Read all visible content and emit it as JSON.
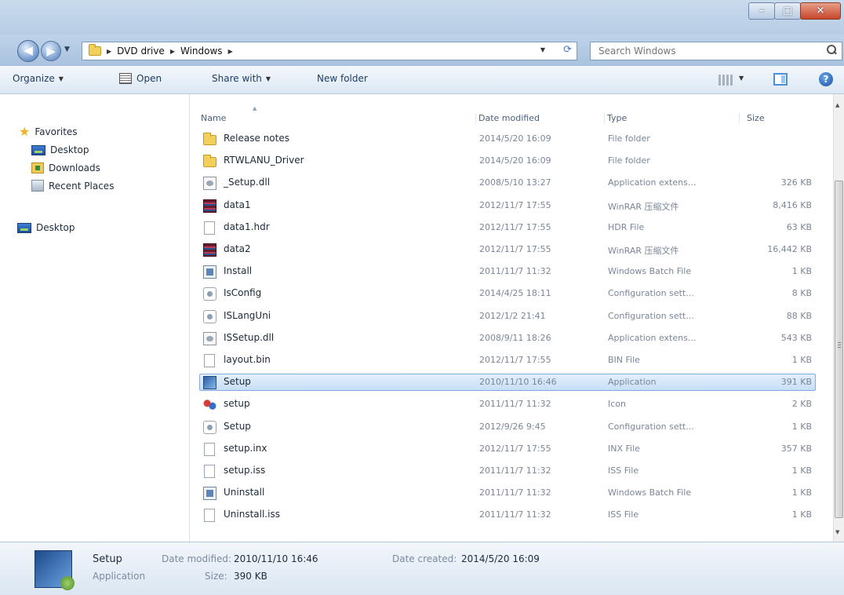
{
  "window": {
    "minimize": "–",
    "maximize": "□",
    "close": "✕"
  },
  "nav": {
    "breadcrumb": [
      "DVD drive",
      "Windows"
    ],
    "search_placeholder": "Search Windows"
  },
  "toolbar": {
    "organize": "Organize",
    "open": "Open",
    "share_with": "Share with",
    "new_folder": "New folder",
    "help": "?"
  },
  "navpane": {
    "favorites": "Favorites",
    "items": [
      "Desktop",
      "Downloads",
      "Recent Places"
    ],
    "desktop_root": "Desktop"
  },
  "columns": {
    "name": "Name",
    "date": "Date modified",
    "type": "Type",
    "size": "Size"
  },
  "files": [
    {
      "name": "Release notes",
      "date": "2014/5/20 16:09",
      "type": "File folder",
      "size": "",
      "icon": "folder-icon"
    },
    {
      "name": "RTWLANU_Driver",
      "date": "2014/5/20 16:09",
      "type": "File folder",
      "size": "",
      "icon": "folder-icon"
    },
    {
      "name": "_Setup.dll",
      "date": "2008/5/10 13:27",
      "type": "Application extens...",
      "size": "326 KB",
      "icon": "dll-icon"
    },
    {
      "name": "data1",
      "date": "2012/11/7 17:55",
      "type": "WinRAR 压缩文件",
      "size": "8,416 KB",
      "icon": "rar-icon"
    },
    {
      "name": "data1.hdr",
      "date": "2012/11/7 17:55",
      "type": "HDR File",
      "size": "63 KB",
      "icon": "file-icon"
    },
    {
      "name": "data2",
      "date": "2012/11/7 17:55",
      "type": "WinRAR 压缩文件",
      "size": "16,442 KB",
      "icon": "rar-icon"
    },
    {
      "name": "Install",
      "date": "2011/11/7 11:32",
      "type": "Windows Batch File",
      "size": "1 KB",
      "icon": "batch-icon"
    },
    {
      "name": "IsConfig",
      "date": "2014/4/25 18:11",
      "type": "Configuration sett...",
      "size": "8 KB",
      "icon": "config-icon"
    },
    {
      "name": "ISLangUni",
      "date": "2012/1/2 21:41",
      "type": "Configuration sett...",
      "size": "88 KB",
      "icon": "config-icon"
    },
    {
      "name": "ISSetup.dll",
      "date": "2008/9/11 18:26",
      "type": "Application extens...",
      "size": "543 KB",
      "icon": "dll-icon"
    },
    {
      "name": "layout.bin",
      "date": "2012/11/7 17:55",
      "type": "BIN File",
      "size": "1 KB",
      "icon": "file-icon"
    },
    {
      "name": "Setup",
      "date": "2010/11/10 16:46",
      "type": "Application",
      "size": "391 KB",
      "icon": "app-icon",
      "selected": true
    },
    {
      "name": "setup",
      "date": "2011/11/7 11:32",
      "type": "Icon",
      "size": "2 KB",
      "icon": "ico-icon"
    },
    {
      "name": "Setup",
      "date": "2012/9/26 9:45",
      "type": "Configuration sett...",
      "size": "1 KB",
      "icon": "config-icon"
    },
    {
      "name": "setup.inx",
      "date": "2012/11/7 17:55",
      "type": "INX File",
      "size": "357 KB",
      "icon": "file-icon"
    },
    {
      "name": "setup.iss",
      "date": "2011/11/7 11:32",
      "type": "ISS File",
      "size": "1 KB",
      "icon": "file-icon"
    },
    {
      "name": "Uninstall",
      "date": "2011/11/7 11:32",
      "type": "Windows Batch File",
      "size": "1 KB",
      "icon": "batch-icon"
    },
    {
      "name": "Uninstall.iss",
      "date": "2011/11/7 11:32",
      "type": "ISS File",
      "size": "1 KB",
      "icon": "file-icon"
    }
  ],
  "details": {
    "name": "Setup",
    "type": "Application",
    "date_modified_label": "Date modified:",
    "date_modified": "2010/11/10 16:46",
    "size_label": "Size:",
    "size": "390 KB",
    "date_created_label": "Date created:",
    "date_created": "2014/5/20 16:09"
  }
}
